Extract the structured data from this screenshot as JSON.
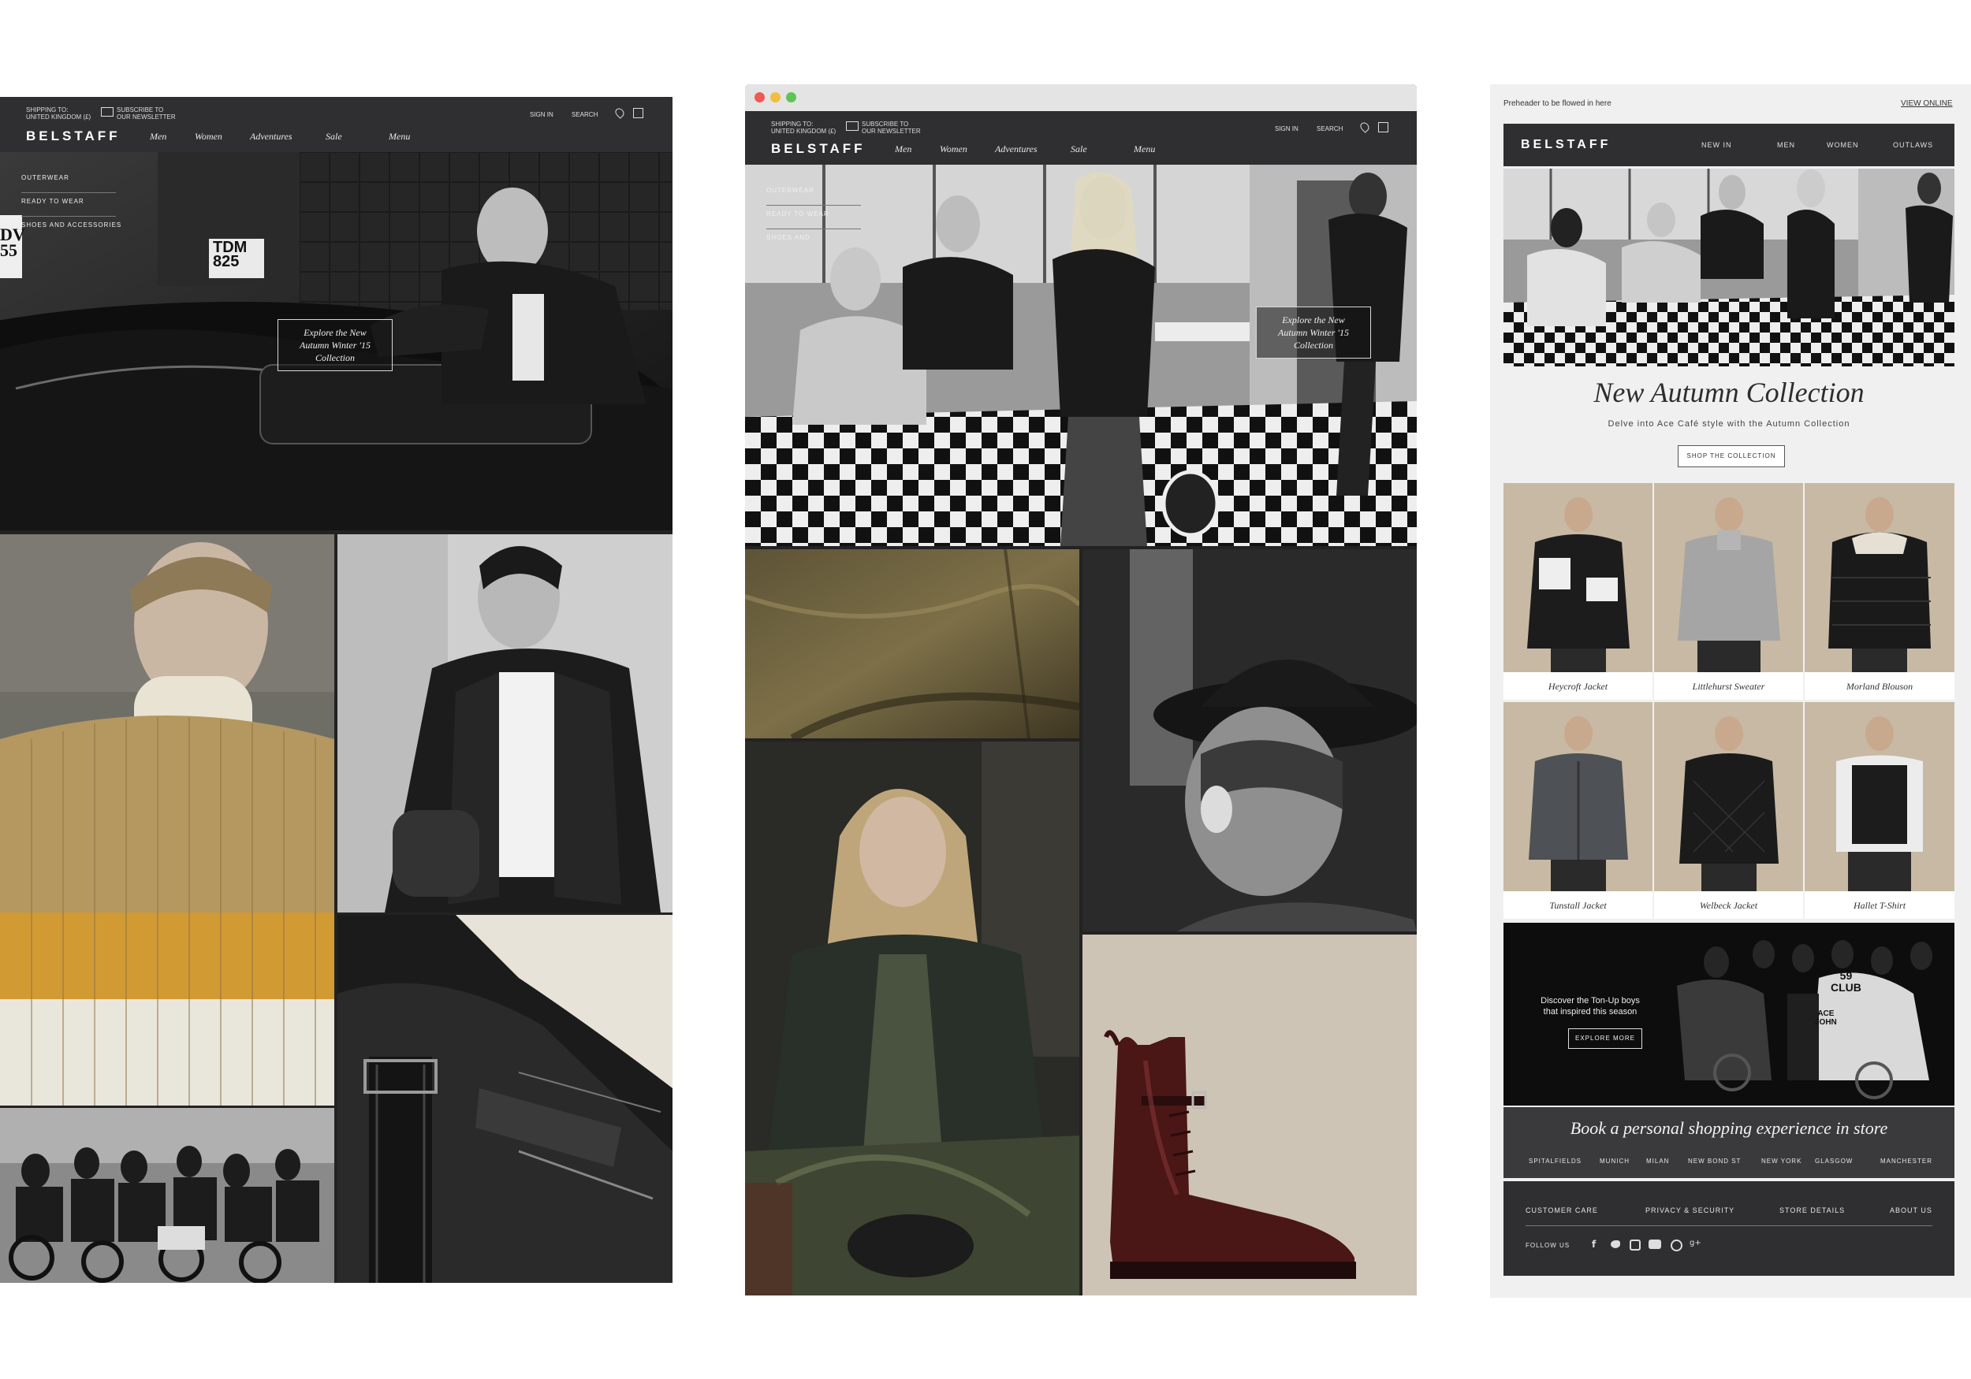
{
  "left": {
    "header": {
      "shipping_label": "SHIPPING TO:",
      "shipping_value": "UNITED KINGDOM (£)",
      "newsletter_line1": "SUBSCRIBE TO",
      "newsletter_line2": "OUR NEWSLETTER",
      "logo": "BELSTAFF",
      "nav": [
        "Men",
        "Women",
        "Adventures",
        "Sale",
        "Menu"
      ],
      "sign_in": "SIGN IN",
      "search": "SEARCH"
    },
    "side_menu": [
      "OUTERWEAR",
      "READY TO WEAR",
      "SHOES AND ACCESSORIES"
    ],
    "hero_cta": [
      "Explore the New",
      "Autumn Winter '15",
      "Collection"
    ],
    "plate_text": [
      "DV",
      "55",
      "TDM",
      "825"
    ]
  },
  "middle": {
    "header": {
      "shipping_label": "SHIPPING TO:",
      "shipping_value": "UNITED KINGDOM (£)",
      "newsletter_line1": "SUBSCRIBE TO",
      "newsletter_line2": "OUR NEWSLETTER",
      "logo": "BELSTAFF",
      "nav": [
        "Men",
        "Women",
        "Adventures",
        "Sale",
        "Menu"
      ],
      "sign_in": "SIGN IN",
      "search": "SEARCH"
    },
    "side_menu": [
      "OUTERWEAR",
      "READY TO WEAR",
      "SHOES AND"
    ],
    "hero_cta": [
      "Explore the New",
      "Autumn Winter '15",
      "Collection"
    ],
    "traffic_colors": [
      "#ee5a52",
      "#f4bd3f",
      "#5fc454"
    ]
  },
  "email": {
    "preheader": "Preheader to be flowed in here",
    "view_online": "VIEW ONLINE",
    "logo": "BELSTAFF",
    "nav": [
      "NEW IN",
      "MEN",
      "WOMEN",
      "OUTLAWS"
    ],
    "headline": "New Autumn Collection",
    "subhead": "Delve into Ace Café style with the Autumn Collection",
    "shop_button": "SHOP THE COLLECTION",
    "products": [
      "Heycroft Jacket",
      "Littlehurst Sweater",
      "Morland Blouson",
      "Tunstall Jacket",
      "Welbeck Jacket",
      "Hallet T-Shirt"
    ],
    "promo_line1": "Discover the Ton-Up boys",
    "promo_line2": "that inspired this season",
    "promo_button": "EXPLORE MORE",
    "promo_jacket_text": [
      "59",
      "CLUB",
      "ACE",
      "JOHN"
    ],
    "book_title": "Book a personal shopping experience in store",
    "stores": [
      "SPITALFIELDS",
      "MUNICH",
      "MILAN",
      "NEW BOND ST",
      "NEW YORK",
      "GLASGOW",
      "MANCHESTER"
    ],
    "footer_links": [
      "CUSTOMER CARE",
      "PRIVACY & SECURITY",
      "STORE DETAILS",
      "ABOUT US"
    ],
    "follow_us": "FOLLOW US",
    "social_icons": [
      "facebook-icon",
      "twitter-icon",
      "instagram-icon",
      "youtube-icon",
      "pinterest-icon",
      "googleplus-icon"
    ]
  }
}
